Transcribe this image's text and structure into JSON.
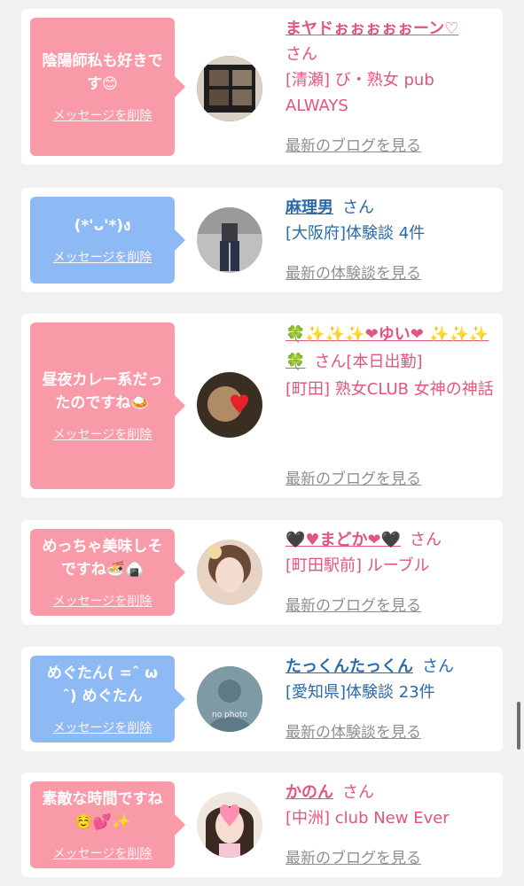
{
  "cards": [
    {
      "message": "陰陽師私も好きです😊",
      "delete_label": "メッセージを削除",
      "name": "まヤドぉぉぉぉぉーン♡",
      "honorific": "さん",
      "detail": "[清瀬] び・熟女 pub ALWAYS",
      "more_label": "最新のブログを見る"
    },
    {
      "message": "(*'ᴗ'*)ง",
      "delete_label": "メッセージを削除",
      "name": "麻理男",
      "honorific": "さん",
      "detail": "[大阪府]体験談 4件",
      "more_label": "最新の体験談を見る"
    },
    {
      "message": "昼夜カレー系だったのですね🍛",
      "delete_label": "メッセージを削除",
      "name": "🍀✨✨✨❤ゆい❤ ✨✨✨🍀",
      "honorific": "さん",
      "status": "[本日出勤]",
      "detail": "[町田] 熟女CLUB 女神の神話",
      "more_label": "最新のブログを見る"
    },
    {
      "message": "めっちゃ美味しそですね🍜🍙",
      "delete_label": "メッセージを削除",
      "name": "🖤♥まどか❤🖤",
      "honorific": "さん",
      "detail": "[町田駅前] ルーブル",
      "more_label": "最新のブログを見る"
    },
    {
      "message": "めぐたん( =ˆ ω ˆ) めぐたん",
      "delete_label": "メッセージを削除",
      "name": "たっくんたっくん",
      "honorific": "さん",
      "detail": "[愛知県]体験談 23件",
      "more_label": "最新の体験談を見る",
      "avatar_text": "no photo"
    },
    {
      "message": "素敵な時間ですね☺️💕✨",
      "delete_label": "メッセージを削除",
      "name": "かのん",
      "honorific": "さん",
      "detail": "[中洲] club New Ever",
      "more_label": "最新のブログを見る"
    }
  ],
  "colors": {
    "pink_bubble": "#f99aa8",
    "blue_bubble": "#8dbaf5",
    "pink_text": "#e2557c",
    "blue_text": "#2a6aa8",
    "link_gray": "#8f8f8f"
  }
}
